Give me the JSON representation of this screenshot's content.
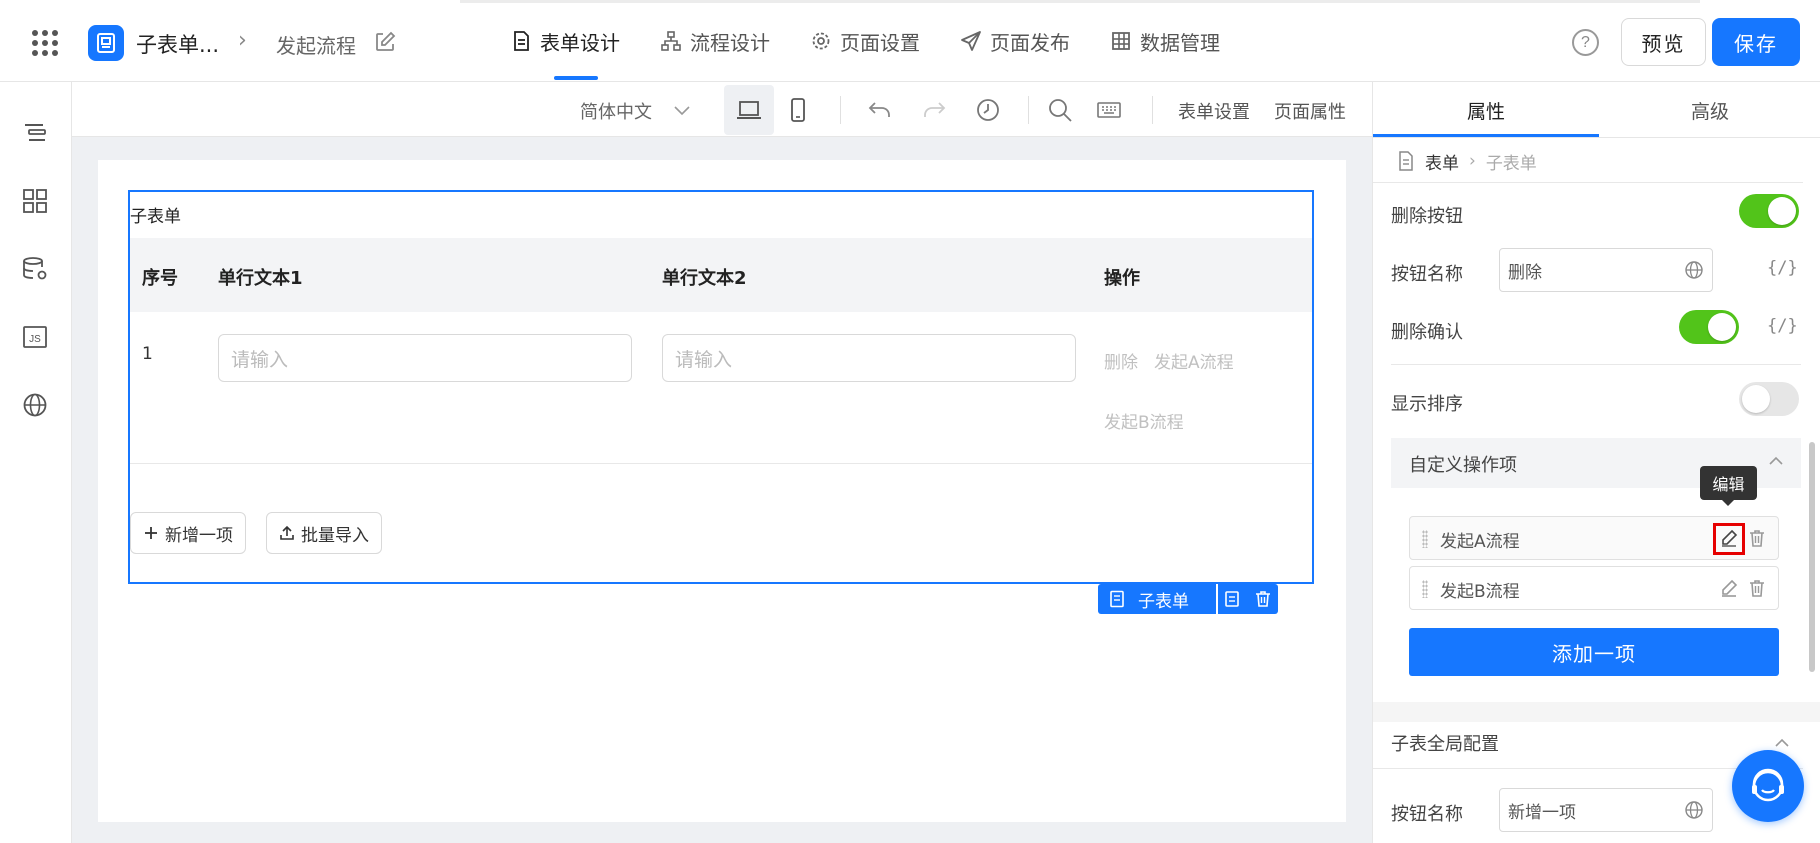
{
  "header": {
    "app_name": "子表单...",
    "flow_name": "发起流程",
    "tabs": [
      {
        "label": "表单设计",
        "icon": "document-icon",
        "active": true
      },
      {
        "label": "流程设计",
        "icon": "flowchart-icon",
        "active": false
      },
      {
        "label": "页面设置",
        "icon": "gear-icon",
        "active": false
      },
      {
        "label": "页面发布",
        "icon": "paper-plane-icon",
        "active": false
      },
      {
        "label": "数据管理",
        "icon": "table-grid-icon",
        "active": false
      }
    ],
    "help_label": "?",
    "preview_label": "预览",
    "save_label": "保存"
  },
  "rail": {
    "items": [
      "outline-icon",
      "components-icon",
      "data-source-icon",
      "js-icon",
      "globe-icon"
    ],
    "js_label": "JS"
  },
  "toolbar": {
    "language": "简体中文",
    "form_settings": "表单设置",
    "page_properties": "页面属性"
  },
  "subform": {
    "title": "子表单",
    "columns": [
      "序号",
      "单行文本1",
      "单行文本2",
      "操作"
    ],
    "rows": [
      {
        "index": "1",
        "input1_placeholder": "请输入",
        "input2_placeholder": "请输入",
        "actions": [
          "删除",
          "发起A流程",
          "发起B流程"
        ]
      }
    ],
    "add_button": "新增一项",
    "import_button": "批量导入",
    "component_tag": "子表单"
  },
  "panel": {
    "tabs": [
      "属性",
      "高级"
    ],
    "active_tab": "属性",
    "breadcrumb": [
      "表单",
      "子表单"
    ],
    "delete_button_label": "删除按钮",
    "delete_button_on": true,
    "button_name_label": "按钮名称",
    "button_name_value": "删除",
    "expr_label": "{/}",
    "delete_confirm_label": "删除确认",
    "delete_confirm_on": true,
    "show_sort_label": "显示排序",
    "show_sort_on": false,
    "custom_ops_title": "自定义操作项",
    "custom_ops": [
      "发起A流程",
      "发起B流程"
    ],
    "tooltip": "编辑",
    "add_item_label": "添加一项",
    "global_config_title": "子表全局配置",
    "global_button_name_label": "按钮名称",
    "global_button_name_value": "新增一项"
  },
  "colors": {
    "accent": "#1677ff",
    "toggle_on": "#52c41a",
    "highlight": "#e60000"
  }
}
